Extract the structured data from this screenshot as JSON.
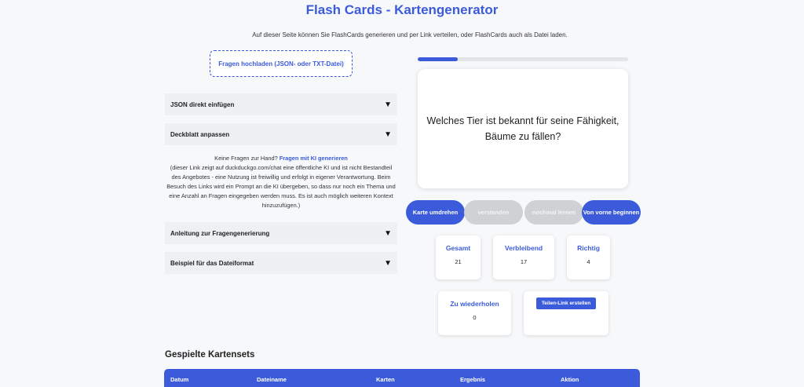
{
  "header": {
    "title": "Flash Cards - Kartengenerator",
    "intro": "Auf dieser Seite können Sie FlashCards generieren und per Link verteilen, oder FlashCards auch als Datei laden."
  },
  "upload": {
    "label": "Fragen hochladen (JSON- oder TXT-Datei)"
  },
  "accordions": {
    "json": "JSON direkt einfügen",
    "cover": "Deckblatt anpassen",
    "guide": "Anleitung zur Fragengenerierung",
    "example": "Beispiel für das Dateiformat",
    "toggle_glyph": "▼"
  },
  "ai_info": {
    "prefix": "Keine Fragen zur Hand? ",
    "link": "Fragen mit KI generieren",
    "text": "(dieser Link zeigt auf duckduckgo.com/chat eine öffentliche KI und ist nicht Bestandteil des Angebotes - eine Nutzung ist freiwillig und erfolgt in eigener Verantwortung. Beim Besuch des Links wird ein Prompt an die KI übergeben, so dass nur noch ein Thema und eine Anzahl an Fragen eingegeben werden muss. Es ist auch möglich weiteren Kontext hinzuzufügen.)"
  },
  "progress": {
    "fraction": 0.19
  },
  "card": {
    "question": "Welches Tier ist bekannt für seine Fähigkeit, Bäume zu fällen?"
  },
  "controls": {
    "flip": "Karte umdrehen",
    "understood": "verstanden",
    "relearn": "nochmal lernen",
    "restart": "Von vorne beginnen"
  },
  "stats": {
    "total_label": "Gesamt",
    "total": "21",
    "remaining_label": "Verbleibend",
    "remaining": "17",
    "correct_label": "Richtig",
    "correct": "4",
    "repeat_label": "Zu wiederholen",
    "repeat": "0",
    "share_button": "Teilen-Link erstellen"
  },
  "sets": {
    "title": "Gespielte Kartensets",
    "columns": [
      "Datum",
      "Dateiname",
      "Karten",
      "Ergebnis",
      "Aktion"
    ]
  },
  "colors": {
    "accent": "#3b5bdb",
    "disabled": "#cfd1d4"
  }
}
